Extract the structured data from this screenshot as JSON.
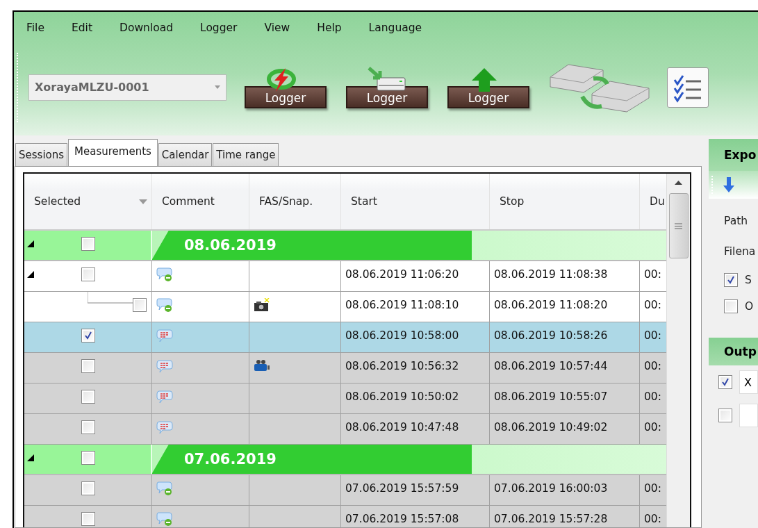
{
  "menu": [
    "File",
    "Edit",
    "Download",
    "Logger",
    "View",
    "Help",
    "Language"
  ],
  "device_combo": {
    "value": "XorayaMLZU-0001",
    "disabled": true
  },
  "toolbar_buttons": [
    {
      "kind": "connect",
      "label": "Logger"
    },
    {
      "kind": "download",
      "label": "Logger"
    },
    {
      "kind": "upload",
      "label": "Logger"
    },
    {
      "kind": "sync"
    },
    {
      "kind": "checklist"
    }
  ],
  "tabs": [
    {
      "label": "Sessions",
      "selected": false
    },
    {
      "label": "Measurements",
      "selected": true
    },
    {
      "label": "Calendar",
      "selected": false
    },
    {
      "label": "Time range",
      "selected": false
    }
  ],
  "table": {
    "columns": [
      "Selected",
      "Comment",
      "FAS/Snap.",
      "Start",
      "Stop",
      "Du"
    ],
    "rows": [
      {
        "kind": "group",
        "date": "08.06.2019",
        "expanded": true,
        "checked": false,
        "children": [
          {
            "kind": "measurement",
            "expanded": true,
            "checked": false,
            "selected": false,
            "greyed": false,
            "has_comment": false,
            "start": "08.06.2019 11:06:20",
            "stop": "08.06.2019 11:08:38",
            "duration": "00:",
            "children": [
              {
                "kind": "measurement",
                "checked": false,
                "selected": false,
                "greyed": false,
                "has_comment": false,
                "snapshot": true,
                "start": "08.06.2019 11:08:10",
                "stop": "08.06.2019 11:08:20",
                "duration": "00:"
              }
            ]
          },
          {
            "kind": "measurement",
            "checked": true,
            "selected": true,
            "greyed": false,
            "has_comment": true,
            "start": "08.06.2019 10:58:00",
            "stop": "08.06.2019 10:58:26",
            "duration": "00:"
          },
          {
            "kind": "measurement",
            "checked": false,
            "selected": false,
            "greyed": true,
            "has_comment": true,
            "video": true,
            "start": "08.06.2019 10:56:32",
            "stop": "08.06.2019 10:57:44",
            "duration": "00:"
          },
          {
            "kind": "measurement",
            "checked": false,
            "selected": false,
            "greyed": true,
            "has_comment": true,
            "start": "08.06.2019 10:50:02",
            "stop": "08.06.2019 10:55:07",
            "duration": "00:"
          },
          {
            "kind": "measurement",
            "checked": false,
            "selected": false,
            "greyed": true,
            "has_comment": true,
            "start": "08.06.2019 10:47:48",
            "stop": "08.06.2019 10:49:02",
            "duration": "00:"
          }
        ]
      },
      {
        "kind": "group",
        "date": "07.06.2019",
        "expanded": true,
        "checked": false,
        "children": [
          {
            "kind": "measurement",
            "checked": false,
            "selected": false,
            "greyed": true,
            "has_comment": false,
            "start": "07.06.2019 15:57:59",
            "stop": "07.06.2019 16:00:03",
            "duration": "00:"
          },
          {
            "kind": "measurement",
            "checked": false,
            "selected": false,
            "greyed": true,
            "has_comment": false,
            "start": "07.06.2019 15:57:08",
            "stop": "07.06.2019 15:57:28",
            "duration": "00:"
          }
        ]
      }
    ]
  },
  "export_panel": {
    "title": "Expo",
    "labels": [
      "Path",
      "Filena"
    ],
    "options": [
      {
        "label": "S",
        "checked": true
      },
      {
        "label": "O",
        "checked": false
      }
    ]
  },
  "output_panel": {
    "title": "Outp",
    "items": [
      {
        "checked": true,
        "value": "X"
      },
      {
        "checked": false
      }
    ]
  }
}
